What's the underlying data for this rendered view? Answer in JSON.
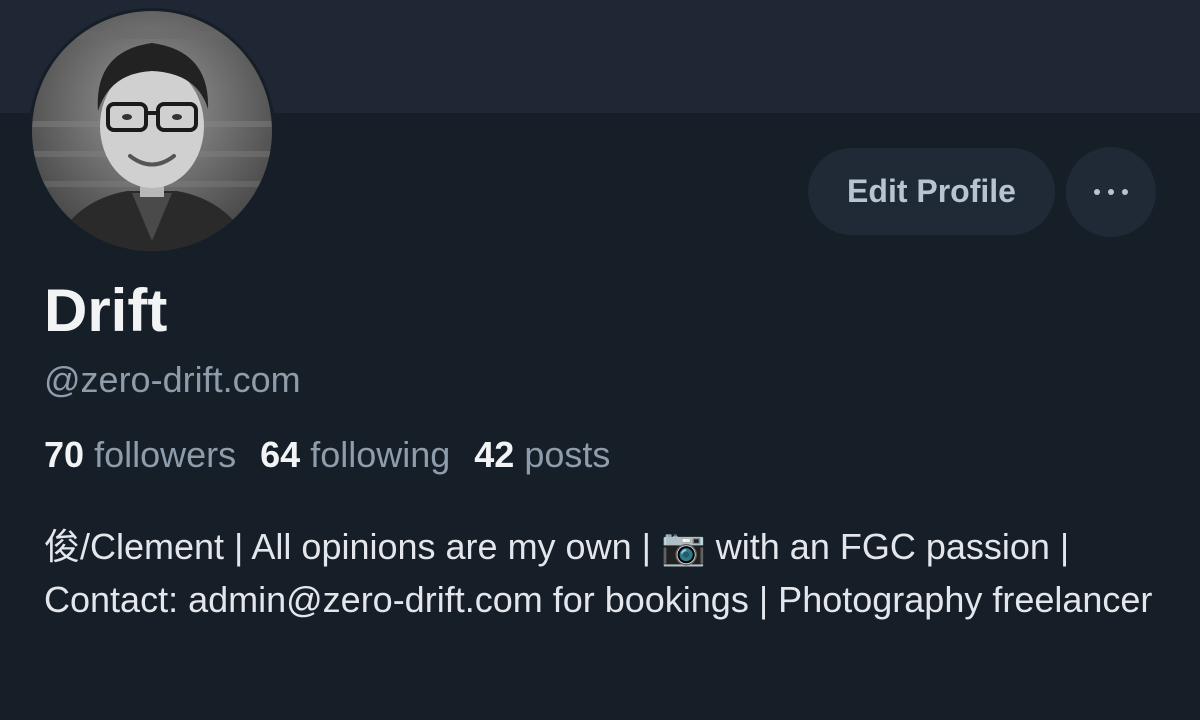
{
  "profile": {
    "display_name": "Drift",
    "handle": "@zero-drift.com",
    "avatar": {
      "icon": "avatar-photo",
      "style": "grayscale portrait of a smiling man with glasses"
    },
    "stats": {
      "followers_count": "70",
      "followers_label": "followers",
      "following_count": "64",
      "following_label": "following",
      "posts_count": "42",
      "posts_label": "posts"
    },
    "bio": "俊/Clement | All opinions are my own | 📷 with an FGC passion | Contact: admin@zero-drift.com for bookings | Photography freelancer"
  },
  "actions": {
    "edit_label": "Edit Profile",
    "more_icon": "more-horizontal-icon"
  },
  "colors": {
    "background": "#161e27",
    "banner": "#1e2733",
    "button_bg": "#1f2a36",
    "button_text": "#b8c4d1",
    "primary_text": "#f1f3f5",
    "secondary_text": "#8e9cab"
  }
}
